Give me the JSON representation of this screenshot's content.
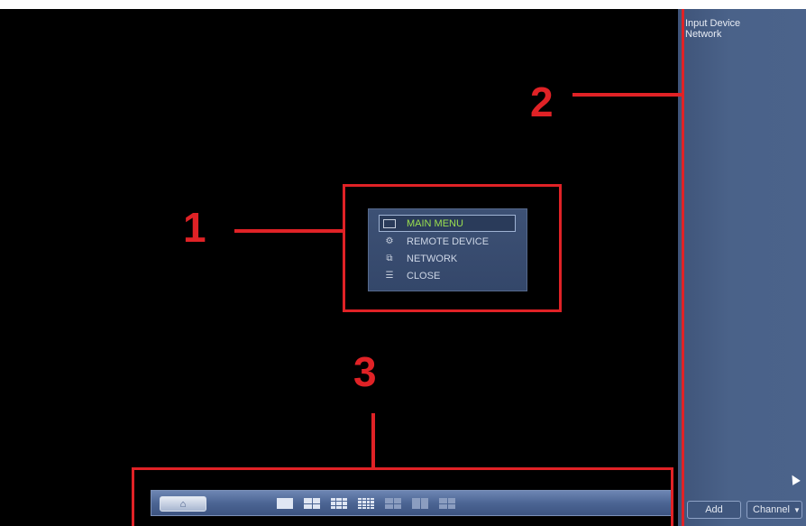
{
  "screen": {
    "background": "#000000"
  },
  "side_panel": {
    "header": [
      "Input Device",
      "Network"
    ],
    "add_button": "Add",
    "channel_select": "Channel"
  },
  "context_menu": {
    "items": [
      {
        "label": "MAIN MENU",
        "icon": "monitor-icon",
        "selected": true
      },
      {
        "label": "REMOTE DEVICE",
        "icon": "remote-device-icon",
        "selected": false
      },
      {
        "label": "NETWORK",
        "icon": "network-icon",
        "selected": false
      },
      {
        "label": "CLOSE",
        "icon": "close-icon",
        "selected": false
      }
    ]
  },
  "taskbar": {
    "home_icon": "home-icon",
    "layouts": [
      "1-view",
      "4-view",
      "9-view",
      "16-view",
      "layout-5",
      "layout-6",
      "layout-7"
    ]
  },
  "annotations": {
    "labels": [
      "1",
      "2",
      "3"
    ],
    "color": "#e02226"
  }
}
